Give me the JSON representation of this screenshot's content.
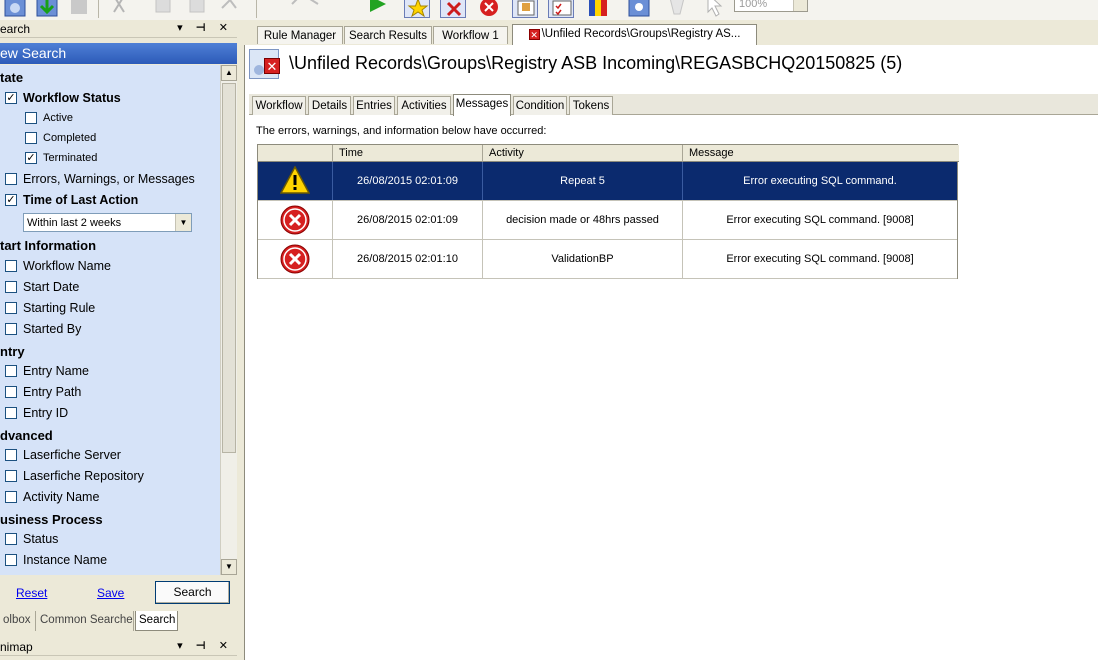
{
  "toolbar": {
    "zoom": "100%"
  },
  "left_pane": {
    "search_panel_title": "earch",
    "new_search": "ew Search",
    "sections": {
      "state": "tate",
      "start_information": "tart Information",
      "entry": "ntry",
      "advanced": "dvanced",
      "business_process": "usiness Process"
    },
    "items": {
      "workflow_status": "Workflow Status",
      "active": "Active",
      "completed": "Completed",
      "terminated": "Terminated",
      "errors": "Errors, Warnings, or Messages",
      "time_of_last_action": "Time of Last Action",
      "time_range": "Within last 2 weeks",
      "workflow_name": "Workflow Name",
      "start_date": "Start Date",
      "starting_rule": "Starting Rule",
      "started_by": "Started By",
      "entry_name": "Entry Name",
      "entry_path": "Entry Path",
      "entry_id": "Entry ID",
      "laserfiche_server": "Laserfiche Server",
      "laserfiche_repository": "Laserfiche Repository",
      "activity_name": "Activity Name",
      "status": "Status",
      "instance_name": "Instance Name"
    },
    "reset": "Reset",
    "save": "Save",
    "search_button": "Search",
    "bottom_tabs": [
      "olbox",
      "Common Searches",
      "Search"
    ],
    "minimap_title": "nimap",
    "panel_controls": "▾ ⊣ ✕"
  },
  "doc_tabs": [
    "Rule Manager",
    "Search Results",
    "Workflow 1",
    "\\Unfiled Records\\Groups\\Registry AS..."
  ],
  "doc": {
    "title": "\\Unfiled Records\\Groups\\Registry ASB Incoming\\REGASBCHQ20150825 (5)",
    "inner_tabs": [
      "Workflow",
      "Details",
      "Entries",
      "Activities",
      "Messages",
      "Condition",
      "Tokens"
    ],
    "note": "The errors, warnings, and information below have occurred:",
    "columns": [
      "Time",
      "Activity",
      "Message"
    ],
    "rows": [
      {
        "type": "warning",
        "time": "26/08/2015 02:01:09",
        "activity": "Repeat 5",
        "message": "Error executing SQL command."
      },
      {
        "type": "error",
        "time": "26/08/2015 02:01:09",
        "activity": "decision made or 48hrs passed",
        "message": "Error executing SQL command. [9008]"
      },
      {
        "type": "error",
        "time": "26/08/2015 02:01:10",
        "activity": "ValidationBP",
        "message": "Error executing SQL command. [9008]"
      }
    ]
  },
  "colors": {
    "selection": "#0b2a6e",
    "header_blue": "#3466c4",
    "error_red": "#d62020",
    "warning_yellow": "#ffd400"
  }
}
